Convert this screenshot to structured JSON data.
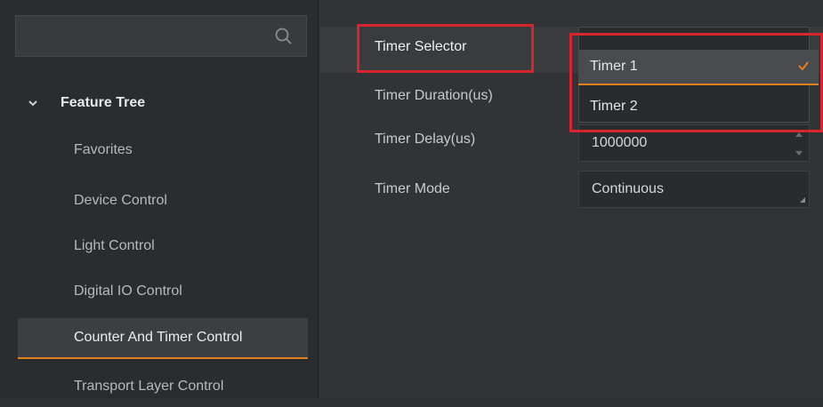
{
  "sidebar": {
    "search": {
      "placeholder": ""
    },
    "tree_title": "Feature Tree",
    "items": [
      {
        "label": "Favorites"
      },
      {
        "label": "Device Control"
      },
      {
        "label": "Light Control"
      },
      {
        "label": "Digital IO Control"
      },
      {
        "label": "Counter And Timer Control",
        "active": true
      },
      {
        "label": "Transport Layer Control"
      }
    ]
  },
  "properties": [
    {
      "label": "Timer Selector"
    },
    {
      "label": "Timer Duration(us)"
    },
    {
      "label": "Timer Delay(us)",
      "value": "1000000"
    },
    {
      "label": "Timer Mode",
      "value": "Continuous"
    }
  ],
  "dropdown": {
    "options": [
      "Timer 1",
      "Timer 2"
    ],
    "selected": "Timer 1"
  },
  "colors": {
    "accent": "#e0801f",
    "highlight_box": "#d8242c"
  },
  "icons": {
    "search": "search-icon",
    "expand": "chevron-down-icon",
    "selected": "checkmark-icon"
  }
}
